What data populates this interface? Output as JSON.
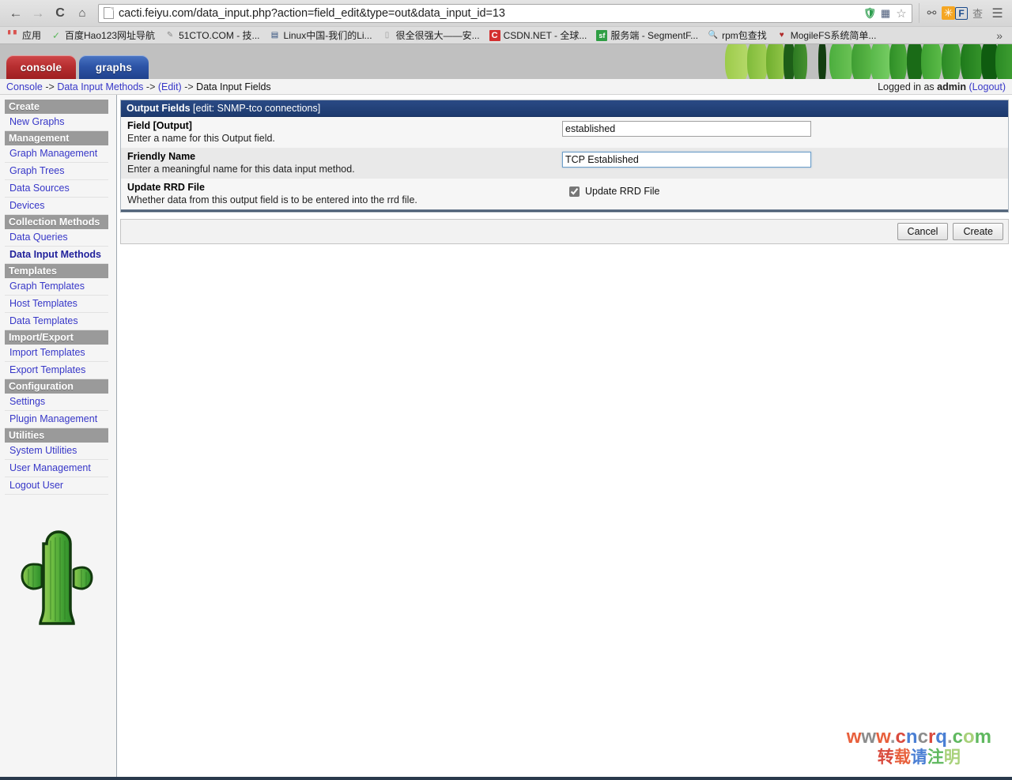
{
  "browser": {
    "back_icon": "←",
    "forward_icon": "→",
    "reload_icon": "C",
    "home_icon": "⌂",
    "url": "cacti.feiyu.com/data_input.php?action=field_edit&type=out&data_input_id=13",
    "url_icons": [
      {
        "name": "shield-icon",
        "glyph": "U",
        "color": "#2e9e4f"
      },
      {
        "name": "translate-icon",
        "glyph": "⁋",
        "color": "#4a5a78"
      },
      {
        "name": "bookmark-star-icon",
        "glyph": "☆",
        "color": "#8a8a8a"
      }
    ],
    "extension_icons": [
      {
        "name": "lamp-icon",
        "glyph": "⚲",
        "color": "#444444",
        "bg": "transparent"
      },
      {
        "name": "sparkle-icon",
        "glyph": "✳",
        "color": "#ffffff",
        "bg": "#f5a623"
      },
      {
        "name": "flash-f-icon",
        "glyph": "F",
        "color": "#1a4b8c",
        "bg": "#ffffff"
      },
      {
        "name": "chinese-badge-icon",
        "glyph": "查",
        "color": "#777777",
        "bg": "transparent"
      },
      {
        "name": "menu-icon",
        "glyph": "☰",
        "color": "#444444",
        "bg": "transparent"
      }
    ],
    "bookmarks": [
      {
        "label": "应用",
        "icon": "apps-grid-icon",
        "glyph": "⠿",
        "color": "#d9534f",
        "bg": "transparent"
      },
      {
        "label": "百度Hao123网址导航",
        "icon": "hao123-icon",
        "glyph": "✓",
        "color": "#5cb85c",
        "bg": "transparent"
      },
      {
        "label": "51CTO.COM - 技...",
        "icon": "pencil-icon",
        "glyph": "✎",
        "color": "#888888",
        "bg": "transparent"
      },
      {
        "label": "Linux中国-我们的Li...",
        "icon": "book-icon",
        "glyph": "▤",
        "color": "#2b4b7a",
        "bg": "transparent"
      },
      {
        "label": "很全很强大——安...",
        "icon": "page-icon",
        "glyph": "▯",
        "color": "#9a9a9a",
        "bg": "transparent"
      },
      {
        "label": "CSDN.NET - 全球...",
        "icon": "csdn-icon",
        "glyph": "C",
        "color": "#ffffff",
        "bg": "#d32f2f"
      },
      {
        "label": "服务端 - SegmentF...",
        "icon": "segmentfault-icon",
        "glyph": "sf",
        "color": "#ffffff",
        "bg": "#2f9e44"
      },
      {
        "label": "rpm包查找",
        "icon": "search-icon",
        "glyph": "🔍",
        "color": "#222222",
        "bg": "transparent"
      },
      {
        "label": "MogileFS系统简单...",
        "icon": "shield-icon",
        "glyph": "♥",
        "color": "#b02a2a",
        "bg": "transparent"
      }
    ],
    "bookmark_overflow": "»"
  },
  "app": {
    "tabs": [
      {
        "label": "console",
        "active": true
      },
      {
        "label": "graphs",
        "active": false
      }
    ],
    "breadcrumb": {
      "items": [
        "Console",
        "Data Input Methods",
        "(Edit)"
      ],
      "current": "Data Input Fields",
      "separator": "->"
    },
    "login": {
      "prefix": "Logged in as",
      "user": "admin",
      "logout_label": "(Logout)"
    }
  },
  "sidebar": {
    "groups": [
      {
        "header": "Create",
        "items": [
          {
            "label": "New Graphs",
            "active": false
          }
        ]
      },
      {
        "header": "Management",
        "items": [
          {
            "label": "Graph Management",
            "active": false
          },
          {
            "label": "Graph Trees",
            "active": false
          },
          {
            "label": "Data Sources",
            "active": false
          },
          {
            "label": "Devices",
            "active": false
          }
        ]
      },
      {
        "header": "Collection Methods",
        "items": [
          {
            "label": "Data Queries",
            "active": false
          },
          {
            "label": "Data Input Methods",
            "active": true
          }
        ]
      },
      {
        "header": "Templates",
        "items": [
          {
            "label": "Graph Templates",
            "active": false
          },
          {
            "label": "Host Templates",
            "active": false
          },
          {
            "label": "Data Templates",
            "active": false
          }
        ]
      },
      {
        "header": "Import/Export",
        "items": [
          {
            "label": "Import Templates",
            "active": false
          },
          {
            "label": "Export Templates",
            "active": false
          }
        ]
      },
      {
        "header": "Configuration",
        "items": [
          {
            "label": "Settings",
            "active": false
          },
          {
            "label": "Plugin Management",
            "active": false
          }
        ]
      },
      {
        "header": "Utilities",
        "items": [
          {
            "label": "System Utilities",
            "active": false
          },
          {
            "label": "User Management",
            "active": false
          },
          {
            "label": "Logout User",
            "active": false
          }
        ]
      }
    ],
    "logo_name": "cacti-cactus-logo"
  },
  "form": {
    "panel_title_strong": "Output Fields",
    "panel_title_context": "[edit: SNMP-tco connections]",
    "rows": [
      {
        "title": "Field [Output]",
        "description": "Enter a name for this Output field.",
        "control": "text",
        "value": "established",
        "focused": false
      },
      {
        "title": "Friendly Name",
        "description": "Enter a meaningful name for this data input method.",
        "control": "text",
        "value": "TCP Established",
        "focused": true
      },
      {
        "title": "Update RRD File",
        "description": "Whether data from this output field is to be entered into the rrd file.",
        "control": "checkbox",
        "checkbox_label": "Update RRD File",
        "checked": true
      }
    ],
    "buttons": [
      {
        "label": "Cancel",
        "name": "cancel-button"
      },
      {
        "label": "Create",
        "name": "create-button"
      }
    ]
  },
  "watermark": {
    "line1_chars": [
      "w",
      "w",
      "w",
      ".",
      "c",
      "n",
      "c",
      "r",
      "q",
      ".",
      "c",
      "o",
      "m"
    ],
    "line1": "www.cncrq.com",
    "line2_chars": [
      "转",
      "载",
      "请",
      "注",
      "明"
    ],
    "line2": "转载请注明"
  },
  "colors": {
    "panel_header": "#1d3a6e",
    "link": "#3737c8",
    "nav_header_bg": "#9a9a9a",
    "console_tab": "#b82f31",
    "graphs_tab": "#2e55a8",
    "cactus_green": "#4caf50"
  }
}
